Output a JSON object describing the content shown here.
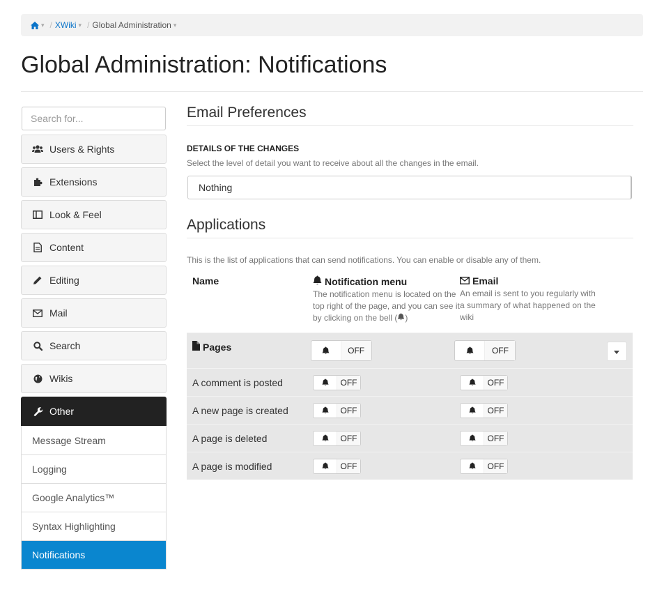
{
  "breadcrumb": {
    "home_icon": "home-icon",
    "items": [
      "XWiki",
      "Global Administration"
    ]
  },
  "page_title": "Global Administration: Notifications",
  "sidebar": {
    "search_placeholder": "Search for...",
    "items": [
      {
        "label": "Users & Rights",
        "icon": "users-icon"
      },
      {
        "label": "Extensions",
        "icon": "puzzle-icon"
      },
      {
        "label": "Look & Feel",
        "icon": "layout-icon"
      },
      {
        "label": "Content",
        "icon": "document-icon"
      },
      {
        "label": "Editing",
        "icon": "pencil-icon"
      },
      {
        "label": "Mail",
        "icon": "envelope-icon"
      },
      {
        "label": "Search",
        "icon": "search-icon"
      },
      {
        "label": "Wikis",
        "icon": "globe-icon"
      },
      {
        "label": "Other",
        "icon": "wrench-icon"
      }
    ],
    "sub_items": [
      "Message Stream",
      "Logging",
      "Google Analytics™",
      "Syntax Highlighting",
      "Notifications"
    ],
    "selected_sub_item": "Notifications"
  },
  "email_prefs": {
    "heading": "Email Preferences",
    "label": "DETAILS OF THE CHANGES",
    "hint": "Select the level of detail you want to receive about all the changes in the email.",
    "value": "Nothing"
  },
  "applications": {
    "heading": "Applications",
    "intro": "This is the list of applications that can send notifications. You can enable or disable any of them.",
    "columns": {
      "name": "Name",
      "notification_title": "Notification menu",
      "notification_desc_before": "The notification menu is located on the top right of the page, and you can see it by clicking on the bell (",
      "notification_desc_after": ")",
      "email_title": "Email",
      "email_desc": "An email is sent to you regularly with a summary of what happened on the wiki"
    },
    "toggle_off_label": "OFF",
    "parent_row": "Pages",
    "rows": [
      "A comment is posted",
      "A new page is created",
      "A page is deleted",
      "A page is modified"
    ]
  },
  "colors": {
    "accent": "#0a86cf",
    "active_menu": "#222222",
    "row_bg": "#e7e7e7"
  }
}
